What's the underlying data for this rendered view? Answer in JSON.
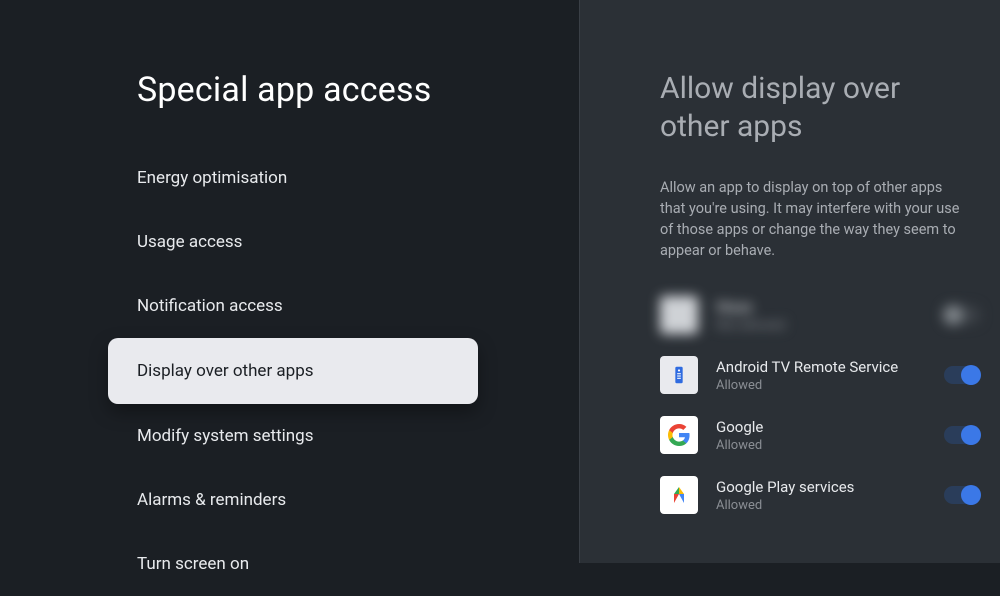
{
  "left": {
    "title": "Special app access",
    "items": [
      {
        "label": "Energy optimisation",
        "selected": false
      },
      {
        "label": "Usage access",
        "selected": false
      },
      {
        "label": "Notification access",
        "selected": false
      },
      {
        "label": "Display over other apps",
        "selected": true
      },
      {
        "label": "Modify system settings",
        "selected": false
      },
      {
        "label": "Alarms & reminders",
        "selected": false
      },
      {
        "label": "Turn screen on",
        "selected": false
      }
    ]
  },
  "right": {
    "title": "Allow display over other apps",
    "description": "Allow an app to display on top of other apps that you're using. It may interfere with your use of those apps or change the way they seem to appear or behave.",
    "apps": [
      {
        "name": "Waze",
        "status": "Not allowed",
        "enabled": false,
        "blurred": true,
        "icon": "blurred"
      },
      {
        "name": "Android TV Remote Service",
        "status": "Allowed",
        "enabled": true,
        "blurred": false,
        "icon": "tv-remote"
      },
      {
        "name": "Google",
        "status": "Allowed",
        "enabled": true,
        "blurred": false,
        "icon": "google"
      },
      {
        "name": "Google Play services",
        "status": "Allowed",
        "enabled": true,
        "blurred": false,
        "icon": "play-services"
      }
    ]
  }
}
